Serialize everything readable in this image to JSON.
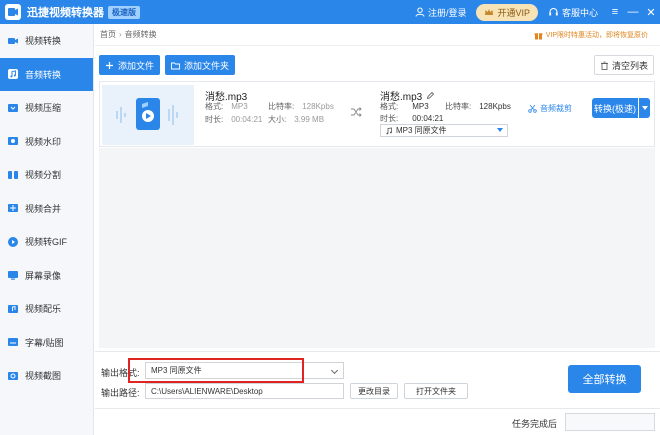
{
  "titlebar": {
    "app_title": "迅捷视频转换器",
    "edition_badge": "极速版",
    "login": "注册/登录",
    "vip": "开通VIP",
    "customer_service": "客服中心",
    "menu_icon": "≡",
    "minimize": "—",
    "close": "✕"
  },
  "sidebar": {
    "items": [
      {
        "label": "视频转换",
        "icon": "video-convert-icon"
      },
      {
        "label": "音频转换",
        "icon": "audio-convert-icon",
        "active": true
      },
      {
        "label": "视频压缩",
        "icon": "video-compress-icon"
      },
      {
        "label": "视频水印",
        "icon": "watermark-icon"
      },
      {
        "label": "视频分割",
        "icon": "split-icon"
      },
      {
        "label": "视频合并",
        "icon": "merge-icon"
      },
      {
        "label": "视频转GIF",
        "icon": "gif-icon"
      },
      {
        "label": "屏幕录像",
        "icon": "screen-record-icon"
      },
      {
        "label": "视频配乐",
        "icon": "music-icon"
      },
      {
        "label": "字幕/贴图",
        "icon": "subtitle-icon"
      },
      {
        "label": "视频截图",
        "icon": "screenshot-icon"
      }
    ]
  },
  "breadcrumb": {
    "home": "首页",
    "separator": "›",
    "current": "音频转换"
  },
  "promo": "VIP限时特惠活动，即将恢复原价",
  "toolbar": {
    "add_file": "添加文件",
    "add_folder": "添加文件夹",
    "clear_list": "清空列表"
  },
  "file": {
    "source": {
      "name": "消愁.mp3",
      "format_label": "格式:",
      "format": "MP3",
      "bitrate_label": "比特率:",
      "bitrate": "128Kpbs",
      "duration_label": "时长:",
      "duration": "00:04:21",
      "size_label": "大小:",
      "size": "3.99 MB"
    },
    "output": {
      "name": "消愁.mp3",
      "format_label": "格式:",
      "format": "MP3",
      "bitrate_label": "比特率:",
      "bitrate": "128Kpbs",
      "duration_label": "时长:",
      "duration": "00:04:21",
      "select_value": "MP3  同原文件"
    },
    "clip": "音频裁剪",
    "convert": "转换(极速)"
  },
  "bottom": {
    "format_label": "输出格式:",
    "format_value": "MP3  同原文件",
    "path_label": "输出路径:",
    "path_value": "C:\\Users\\ALIENWARE\\Desktop",
    "change_dir": "更改目录",
    "open_folder": "打开文件夹",
    "convert_all": "全部转换"
  },
  "statusbar": {
    "done_label": "任务完成后"
  },
  "colors": {
    "accent": "#2b86ea",
    "highlight": "#e02323",
    "promo": "#e0861e"
  }
}
